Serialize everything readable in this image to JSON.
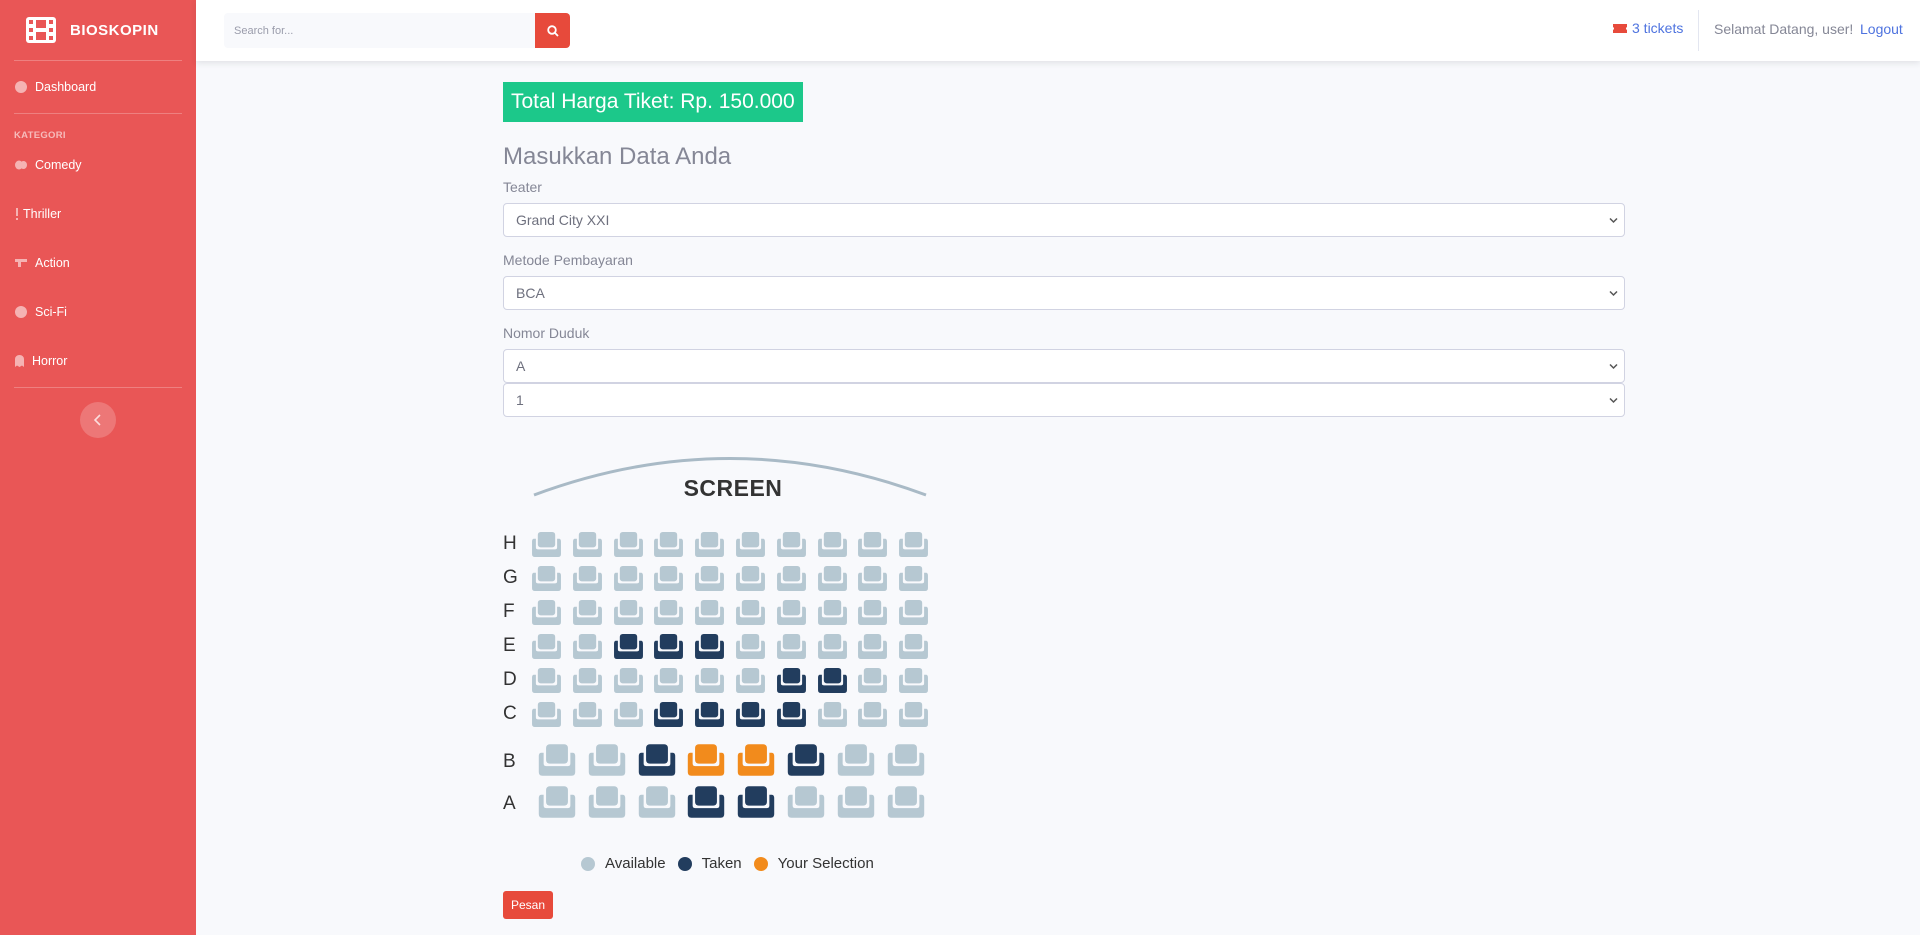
{
  "brand": {
    "name": "BIOSKOPIN",
    "icon": "film-icon"
  },
  "sidebar": {
    "dashboard": "Dashboard",
    "heading": "KATEGORI",
    "categories": [
      {
        "label": "Comedy",
        "icon": "comedy-icon"
      },
      {
        "label": "Thriller",
        "icon": "exclamation-icon"
      },
      {
        "label": "Action",
        "icon": "action-icon"
      },
      {
        "label": "Sci-Fi",
        "icon": "atom-icon"
      },
      {
        "label": "Horror",
        "icon": "ghost-icon"
      }
    ]
  },
  "topbar": {
    "search_placeholder": "Search for...",
    "tickets": "3 tickets",
    "welcome": "Selamat Datang, user!",
    "logout": "Logout"
  },
  "main": {
    "total": "Total Harga Tiket: Rp. 150.000",
    "form_title": "Masukkan Data Anda",
    "teater_label": "Teater",
    "teater_value": "Grand City XXI",
    "payment_label": "Metode Pembayaran",
    "payment_value": "BCA",
    "seat_label": "Nomor Duduk",
    "seat_row_value": "A",
    "seat_number_value": "1",
    "submit": "Pesan"
  },
  "seatmap": {
    "screen_label": "SCREEN",
    "colors": {
      "available": "#b6c8d2",
      "taken": "#223d5e",
      "selected": "#f28b1c"
    },
    "rows": [
      {
        "label": "H",
        "seats": [
          "available",
          "available",
          "available",
          "available",
          "available",
          "available",
          "available",
          "available",
          "available",
          "available"
        ]
      },
      {
        "label": "G",
        "seats": [
          "available",
          "available",
          "available",
          "available",
          "available",
          "available",
          "available",
          "available",
          "available",
          "available"
        ]
      },
      {
        "label": "F",
        "seats": [
          "available",
          "available",
          "available",
          "available",
          "available",
          "available",
          "available",
          "available",
          "available",
          "available"
        ]
      },
      {
        "label": "E",
        "seats": [
          "available",
          "available",
          "taken",
          "taken",
          "taken",
          "available",
          "available",
          "available",
          "available",
          "available"
        ]
      },
      {
        "label": "D",
        "seats": [
          "available",
          "available",
          "available",
          "available",
          "available",
          "available",
          "taken",
          "taken",
          "available",
          "available"
        ]
      },
      {
        "label": "C",
        "seats": [
          "available",
          "available",
          "available",
          "taken",
          "taken",
          "taken",
          "taken",
          "available",
          "available",
          "available"
        ]
      },
      {
        "label": "B",
        "seats": [
          "available",
          "available",
          "taken",
          "selected",
          "selected",
          "taken",
          "available",
          "available"
        ]
      },
      {
        "label": "A",
        "seats": [
          "available",
          "available",
          "available",
          "taken",
          "taken",
          "available",
          "available",
          "available"
        ]
      }
    ],
    "legend": {
      "available": "Available",
      "taken": "Taken",
      "selected": "Your Selection"
    }
  }
}
